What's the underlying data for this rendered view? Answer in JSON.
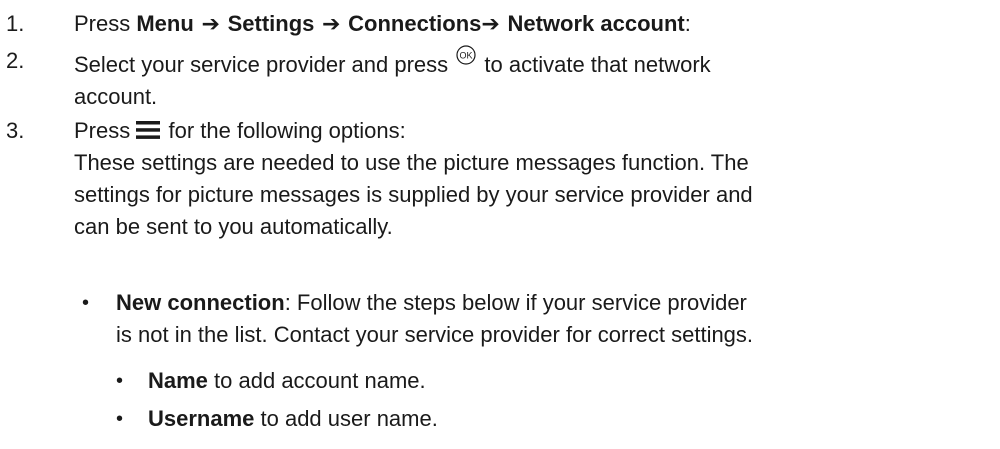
{
  "steps": [
    {
      "number": "1.",
      "parts": {
        "press": "Press ",
        "menu": "Menu",
        "arrow1": " ➔ ",
        "settings": "Settings",
        "arrow2": " ➔ ",
        "connections": "Connections",
        "arrow3": "➔ ",
        "network_account": "Network account",
        "colon": ":"
      }
    },
    {
      "number": "2.",
      "line1_a": "Select your service provider and press ",
      "ok_icon": "ok-key-icon",
      "line1_b": " to activate that network",
      "line2": "account."
    },
    {
      "number": "3.",
      "press": "Press ",
      "menu_icon": "menu-key-icon",
      "after_icon": " for the following options:",
      "para_lines": [
        "These settings are needed to use the picture messages function. The",
        "settings for picture messages is supplied by your service provider and",
        "can be sent to you automatically."
      ]
    }
  ],
  "options": [
    {
      "label": "New connection",
      "line1": ": Follow the steps below if your service provider",
      "line2": "is not in the list. Contact your service provider for correct settings."
    }
  ],
  "sub_options": [
    {
      "label": "Name",
      "text": " to add account name."
    },
    {
      "label": "Username",
      "text": " to add user name."
    }
  ],
  "bullet_char": "•"
}
